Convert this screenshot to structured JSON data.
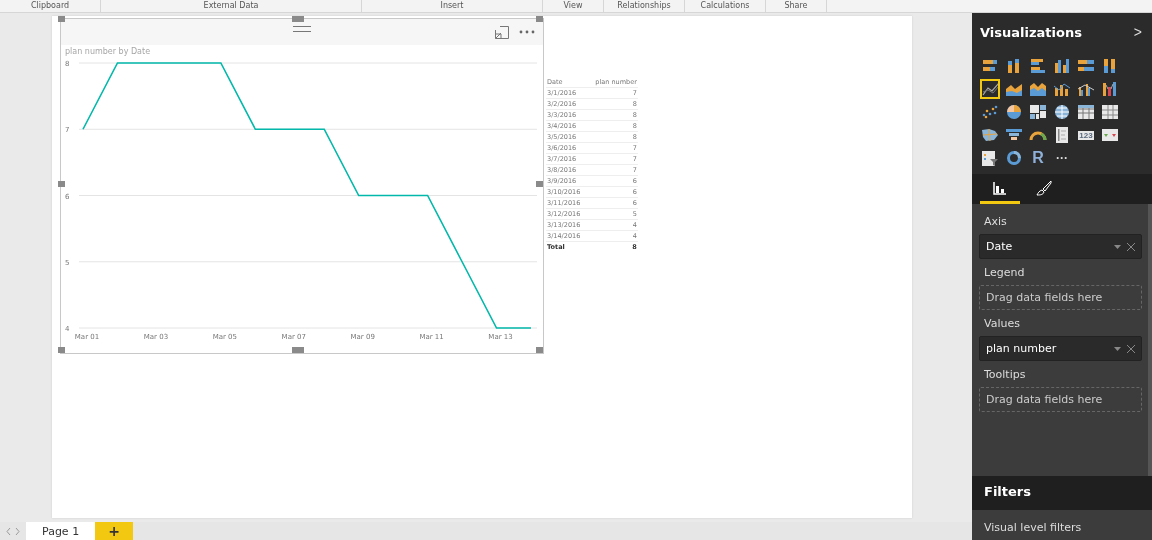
{
  "ribbon": {
    "groups": [
      "Clipboard",
      "External Data",
      "Insert",
      "View",
      "Relationships",
      "Calculations",
      "Share"
    ]
  },
  "visual": {
    "chart_data": {
      "type": "line",
      "title": "plan number by Date",
      "categories": [
        "Mar 01",
        null,
        "Mar 03",
        null,
        "Mar 05",
        null,
        "Mar 07",
        null,
        "Mar 09",
        null,
        "Mar 11",
        null,
        "Mar 13",
        null
      ],
      "grid": true,
      "series": [
        {
          "color": "#01b8aa",
          "values": [
            7,
            8,
            8,
            8,
            8,
            7,
            7,
            7,
            6,
            6,
            6,
            5,
            4,
            4
          ]
        }
      ],
      "ylim": [
        4,
        8
      ],
      "yticks": [
        4,
        5,
        6,
        7,
        8
      ]
    }
  },
  "table": {
    "columns": [
      "Date",
      "plan number"
    ],
    "rows": [
      [
        "3/1/2016",
        "7"
      ],
      [
        "3/2/2016",
        "8"
      ],
      [
        "3/3/2016",
        "8"
      ],
      [
        "3/4/2016",
        "8"
      ],
      [
        "3/5/2016",
        "8"
      ],
      [
        "3/6/2016",
        "7"
      ],
      [
        "3/7/2016",
        "7"
      ],
      [
        "3/8/2016",
        "7"
      ],
      [
        "3/9/2016",
        "6"
      ],
      [
        "3/10/2016",
        "6"
      ],
      [
        "3/11/2016",
        "6"
      ],
      [
        "3/12/2016",
        "5"
      ],
      [
        "3/13/2016",
        "4"
      ],
      [
        "3/14/2016",
        "4"
      ]
    ],
    "total": [
      "Total",
      "8"
    ]
  },
  "page_tabs": {
    "tabs": [
      {
        "label": "Page 1",
        "selected": true
      }
    ],
    "add_button": "+"
  },
  "visualizations": {
    "title": "Visualizations",
    "collapse": ">",
    "items": [
      {
        "kind": "stacked-bar",
        "selected": false
      },
      {
        "kind": "stacked-column",
        "selected": false
      },
      {
        "kind": "clustered-bar",
        "selected": false
      },
      {
        "kind": "clustered-column",
        "selected": false
      },
      {
        "kind": "full-bar",
        "selected": false
      },
      {
        "kind": "full-column",
        "selected": false
      },
      {
        "kind": "line",
        "selected": true
      },
      {
        "kind": "area",
        "selected": false
      },
      {
        "kind": "stacked-area",
        "selected": false
      },
      {
        "kind": "line-column",
        "selected": false
      },
      {
        "kind": "line-clustered",
        "selected": false
      },
      {
        "kind": "ribbon",
        "selected": false
      },
      {
        "kind": "scatter",
        "selected": false
      },
      {
        "kind": "pie",
        "selected": false
      },
      {
        "kind": "treemap",
        "selected": false
      },
      {
        "kind": "map",
        "selected": false
      },
      {
        "kind": "table",
        "selected": false
      },
      {
        "kind": "matrix",
        "selected": false
      },
      {
        "kind": "filled-map",
        "selected": false
      },
      {
        "kind": "funnel",
        "selected": false
      },
      {
        "kind": "gauge",
        "selected": false
      },
      {
        "kind": "multirow-card",
        "selected": false
      },
      {
        "kind": "card",
        "selected": false,
        "glyph": "123"
      },
      {
        "kind": "kpi",
        "selected": false
      },
      {
        "kind": "slicer",
        "selected": false
      },
      {
        "kind": "donut",
        "selected": false
      },
      {
        "kind": "r",
        "selected": false,
        "glyph": "R"
      },
      {
        "kind": "more",
        "selected": false,
        "glyph": "···"
      }
    ],
    "tabs": [
      {
        "kind": "fields",
        "selected": true
      },
      {
        "kind": "format",
        "selected": false
      }
    ],
    "wells": [
      {
        "label": "Axis",
        "field": "Date"
      },
      {
        "label": "Legend",
        "placeholder": "Drag data fields here"
      },
      {
        "label": "Values",
        "field": "plan number"
      },
      {
        "label": "Tooltips",
        "placeholder": "Drag data fields here"
      }
    ]
  },
  "filters": {
    "title": "Filters",
    "sections": [
      "Visual level filters"
    ]
  }
}
